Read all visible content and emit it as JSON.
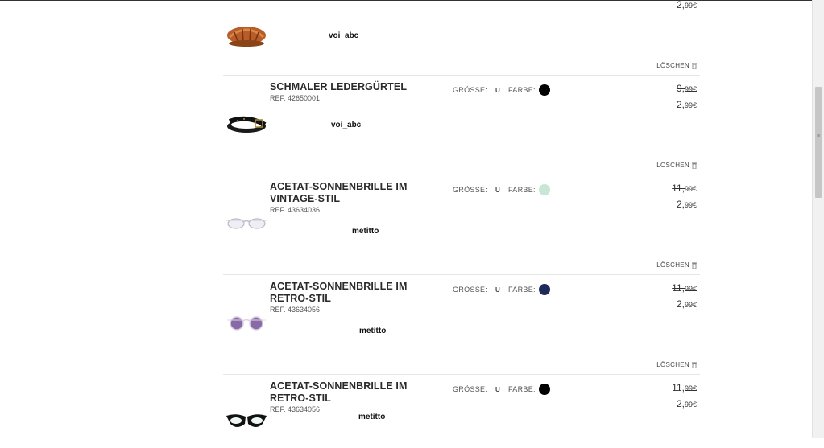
{
  "labels": {
    "size": "GRÖSSE:",
    "color": "FARBE:",
    "delete": "LÖSCHEN"
  },
  "top_item": {
    "price_new": "2,",
    "price_new_cents": "99€",
    "seller": "voi_abc",
    "thumb_icon": "bike-helmet-icon"
  },
  "items": [
    {
      "name": "SCHMALER LEDERGÜRTEL",
      "ref": "REF. 42650001",
      "size": "U",
      "color_hex": "#000000",
      "price_old": "9,",
      "price_old_cents": "99€",
      "price_new": "2,",
      "price_new_cents": "99€",
      "seller": "voi_abc",
      "thumb_icon": "leather-belt-icon"
    },
    {
      "name": "ACETAT-SONNENBRILLE IM VINTAGE-STIL",
      "ref": "REF. 43634036",
      "size": "U",
      "color_hex": "#c8e6d4",
      "price_old": "11,",
      "price_old_cents": "99€",
      "price_new": "2,",
      "price_new_cents": "99€",
      "seller": "metitto",
      "thumb_icon": "clear-sunglasses-icon"
    },
    {
      "name": "ACETAT-SONNENBRILLE IM RETRO-STIL",
      "ref": "REF. 43634056",
      "size": "U",
      "color_hex": "#1f2a5c",
      "price_old": "11,",
      "price_old_cents": "99€",
      "price_new": "2,",
      "price_new_cents": "99€",
      "seller": "metitto",
      "thumb_icon": "purple-sunglasses-icon"
    },
    {
      "name": "ACETAT-SONNENBRILLE IM RETRO-STIL",
      "ref": "REF. 43634056",
      "size": "U",
      "color_hex": "#000000",
      "price_old": "11,",
      "price_old_cents": "99€",
      "price_new": "2,",
      "price_new_cents": "99€",
      "seller": "metitto",
      "thumb_icon": "black-sunglasses-icon"
    }
  ]
}
